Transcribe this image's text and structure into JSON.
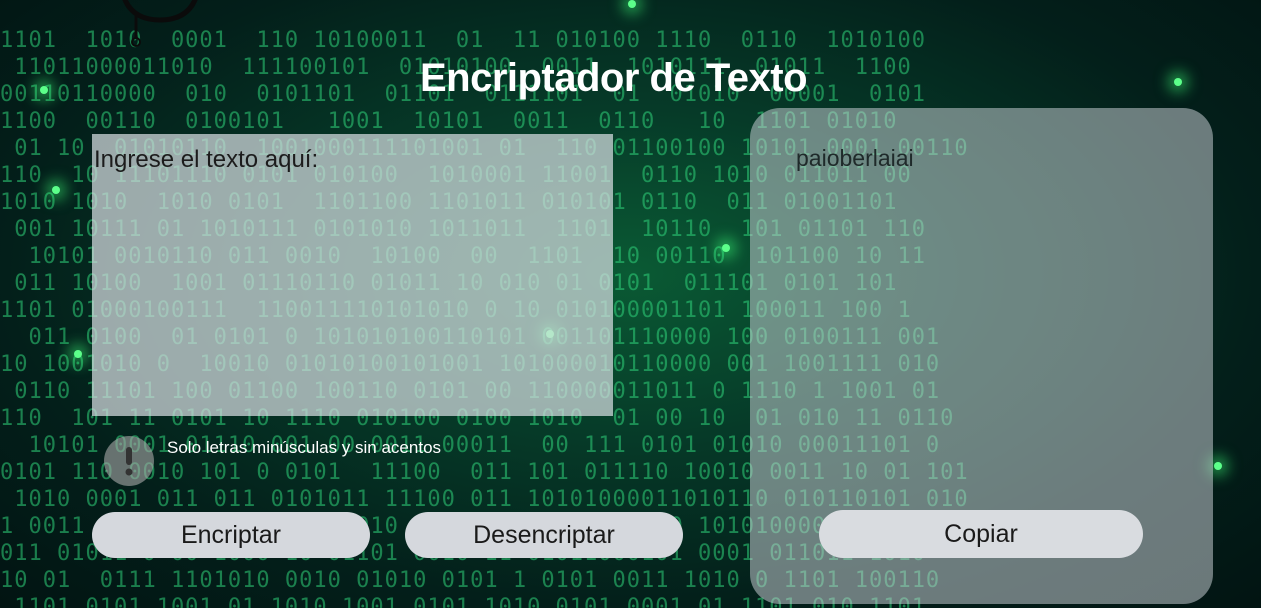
{
  "app": {
    "title": "Encriptador de Texto"
  },
  "input": {
    "placeholder": "Ingrese el texto aquí:",
    "value": ""
  },
  "hint": {
    "icon": "exclamation-icon",
    "text": "Solo letras minúsculas y sin acentos"
  },
  "buttons": {
    "encrypt_label": "Encriptar",
    "decrypt_label": "Desencriptar",
    "copy_label": "Copiar"
  },
  "output": {
    "text": "paioberlaiai"
  },
  "colors": {
    "background": "#063a28",
    "binary_digits": "#2fd27a",
    "button": "#d5d8dd",
    "title": "#ffffff"
  }
}
